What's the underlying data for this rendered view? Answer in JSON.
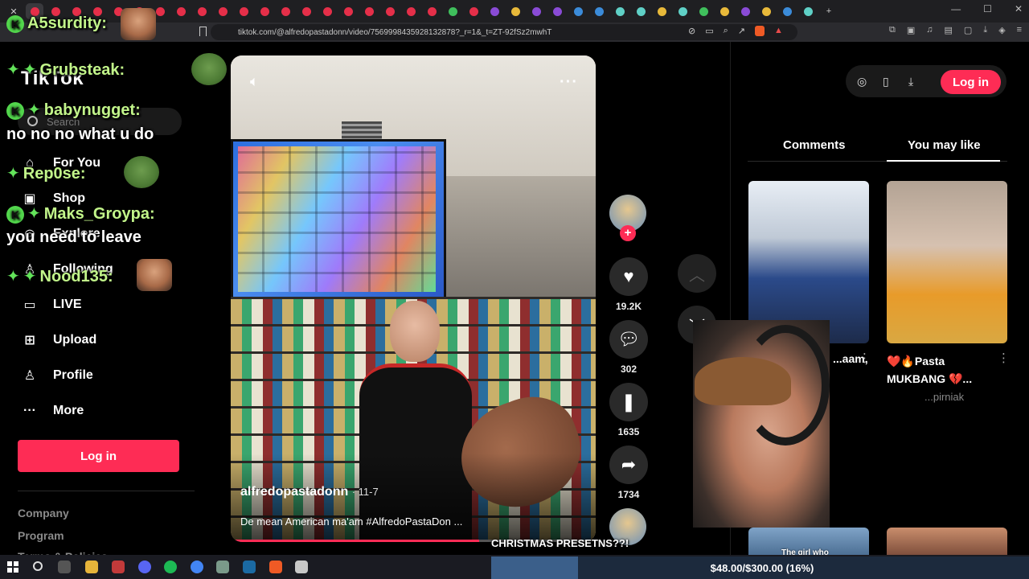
{
  "browser": {
    "url": "tiktok.com/@alfredopastadonn/video/7569998435928132878?_r=1&_t=ZT-92fSz2mwhT"
  },
  "tiktok": {
    "logo": "TikTok",
    "search_placeholder": "Search",
    "nav": [
      {
        "label": "For You",
        "icon": "home-icon"
      },
      {
        "label": "Shop",
        "icon": "shop-icon"
      },
      {
        "label": "Explore",
        "icon": "explore-icon"
      },
      {
        "label": "Following",
        "icon": "following-icon"
      },
      {
        "label": "LIVE",
        "icon": "live-icon"
      },
      {
        "label": "Upload",
        "icon": "upload-icon"
      },
      {
        "label": "Profile",
        "icon": "profile-icon"
      },
      {
        "label": "More",
        "icon": "more-icon"
      }
    ],
    "login_label": "Log in",
    "footer": [
      "Company",
      "Program",
      "Terms & Policies"
    ],
    "video": {
      "author": "alfredopastadonn",
      "date": "· 11-7",
      "description": "De mean American ma'am #AlfredoPastaDon ...",
      "progress_fraction": 0.68
    },
    "actions": {
      "likes": "19.2K",
      "comments": "302",
      "saves": "1635",
      "shares": "1734"
    },
    "right_panel": {
      "tabs": [
        "Comments",
        "You may like"
      ],
      "active_tab": "You may like",
      "login_label": "Log in",
      "recommendations": [
        {
          "title": "...aam,",
          "author": ""
        },
        {
          "title": "❤️🔥Pasta MUKBANG 💔...",
          "author": "...pirniak"
        }
      ],
      "thumb_caption": "The girl who"
    }
  },
  "chat": [
    {
      "user": "A5surdity:",
      "message": ""
    },
    {
      "user": "Grubsteak:",
      "message": ""
    },
    {
      "user": "babynugget:",
      "message": "no no no what u do"
    },
    {
      "user": "Rep0se:",
      "message": ""
    },
    {
      "user": "Maks_Groypa:",
      "message": "you need to leave"
    },
    {
      "user": "Nood135:",
      "message": ""
    }
  ],
  "stream": {
    "caption": "CHRISTMAS PRESETNS??!",
    "goal": "$48.00/$300.00 (16%)",
    "goal_fraction": 0.16
  },
  "colors": {
    "tiktok_red": "#fe2c55",
    "chat_name": "#c2f58a",
    "chat_badge": "#52d64c"
  }
}
